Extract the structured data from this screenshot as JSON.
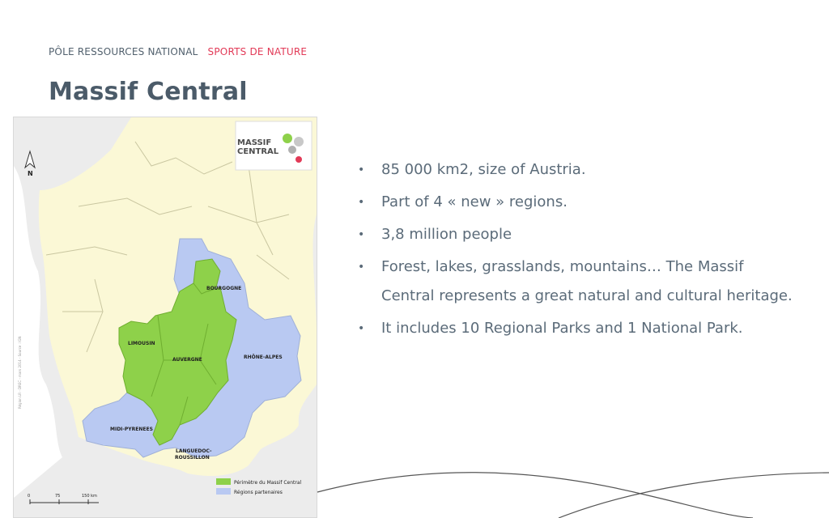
{
  "header": {
    "kicker_left": "PÔLE RESSOURCES NATIONAL",
    "kicker_right": "SPORTS DE NATURE",
    "title": "Massif Central"
  },
  "map": {
    "logo_line1": "MASSIF",
    "logo_line2": "CENTRAL",
    "north": "N",
    "regions": {
      "bourgogne": "BOURGOGNE",
      "limousin": "LIMOUSIN",
      "auvergne": "AUVERGNE",
      "rhone_alpes": "RHÔNE-ALPES",
      "midi_pyrenees": "MIDI-PYRENEES",
      "languedoc_1": "LANGUEDOC-",
      "languedoc_2": "ROUSSILLON"
    },
    "legend": {
      "perimeter": "Périmètre du Massif Central",
      "partners": "Régions partenaires"
    },
    "scale": {
      "zero": "0",
      "mid": "75",
      "end": "150 km"
    },
    "source": "Région LR - DREC - mars 2014 - Source : IGN",
    "colors": {
      "perimeter": "#8ed14a",
      "partners": "#b9c9f2",
      "france": "#fbf8d6",
      "outside": "#ececec",
      "sea": "#ffffff"
    }
  },
  "bullets": [
    "85 000 km2, size of Austria.",
    "Part of 4 « new » regions.",
    "3,8 million people",
    "Forest, lakes, grasslands, mountains…  The Massif Central represents a great  natural and cultural heritage.",
    "It includes 10 Regional Parks and 1 National Park."
  ],
  "bullet_symbol": "•"
}
